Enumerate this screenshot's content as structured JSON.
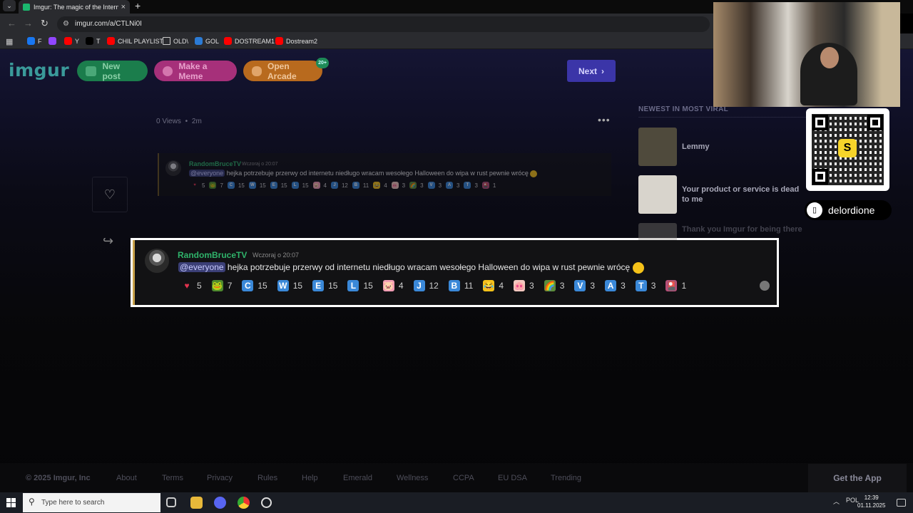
{
  "browser": {
    "tab_title": "Imgur: The magic of the Interne",
    "url": "imgur.com/a/CTLNi0I",
    "bookmarks": [
      {
        "label": "F",
        "color": "#1877f2"
      },
      {
        "label": "",
        "color": "#9146ff"
      },
      {
        "label": "Y",
        "color": "#ff0000"
      },
      {
        "label": "T",
        "color": "#000000"
      },
      {
        "label": "CHIL PLAYLIST",
        "color": "#ff0000"
      },
      {
        "label": "OLD\\",
        "color": "folder"
      },
      {
        "label": "GOL",
        "color": "#2b7bd5"
      },
      {
        "label": "DOSTREAM1",
        "color": "#ff0000"
      },
      {
        "label": "Dostream2",
        "color": "#ff0000"
      }
    ]
  },
  "header": {
    "logo": "imgur",
    "new_post": "New post",
    "make_meme": "Make a Meme",
    "open_arcade": "Open Arcade",
    "arcade_badge": "20+",
    "next": "Next"
  },
  "post": {
    "views": "0 Views",
    "dot": "•",
    "age": "2m"
  },
  "message": {
    "username": "RandomBruceTV",
    "timestamp": "Wczoraj o 20:07",
    "mention": "@everyone",
    "text": "hejka potrzebuje przerwy od internetu niedługo wracam wesołego Halloween do wipa w rust pewnie wrócę",
    "reactions": [
      {
        "emoji": "♥",
        "bg": "transparent",
        "fg": "#e2334f",
        "count": "5"
      },
      {
        "emoji": "🐸",
        "bg": "#4e8a2e",
        "fg": "#fff",
        "count": "7"
      },
      {
        "emoji": "C",
        "bg": "#3a88d8",
        "fg": "#fff",
        "count": "15"
      },
      {
        "emoji": "W",
        "bg": "#3a88d8",
        "fg": "#fff",
        "count": "15"
      },
      {
        "emoji": "E",
        "bg": "#3a88d8",
        "fg": "#fff",
        "count": "15"
      },
      {
        "emoji": "L",
        "bg": "#3a88d8",
        "fg": "#fff",
        "count": "15"
      },
      {
        "emoji": "🐷",
        "bg": "#f19cb4",
        "fg": "#fff",
        "count": "4"
      },
      {
        "emoji": "J",
        "bg": "#3a88d8",
        "fg": "#fff",
        "count": "12"
      },
      {
        "emoji": "B",
        "bg": "#3a88d8",
        "fg": "#fff",
        "count": "11"
      },
      {
        "emoji": "😂",
        "bg": "#f5c219",
        "fg": "#000",
        "count": "4"
      },
      {
        "emoji": "🐽",
        "bg": "#f4c8bf",
        "fg": "#000",
        "count": "3"
      },
      {
        "emoji": "🌈",
        "bg": "#5b8d3a",
        "fg": "#fff",
        "count": "3"
      },
      {
        "emoji": "V",
        "bg": "#3a88d8",
        "fg": "#fff",
        "count": "3"
      },
      {
        "emoji": "A",
        "bg": "#3a88d8",
        "fg": "#fff",
        "count": "3"
      },
      {
        "emoji": "T",
        "bg": "#3a88d8",
        "fg": "#fff",
        "count": "3"
      },
      {
        "emoji": "🎴",
        "bg": "#b84e78",
        "fg": "#fff",
        "count": "1"
      }
    ]
  },
  "sidebar": {
    "heading": "NEWEST IN MOST VIRAL",
    "items": [
      {
        "title": "Lemmy",
        "thumb": "#4f4a3c"
      },
      {
        "title": "Your product or service is dead to me",
        "thumb": "#d8d4cc"
      },
      {
        "title": "Thank you Imgur for being there",
        "thumb": "#8f8a82"
      }
    ]
  },
  "overlay": {
    "qr_logo": "S",
    "social_handle": "delordione"
  },
  "footer": {
    "copyright": "© 2025 Imgur, Inc",
    "links": [
      "About",
      "Terms",
      "Privacy",
      "Rules",
      "Help",
      "Emerald",
      "Wellness",
      "CCPA",
      "EU DSA",
      "Trending"
    ],
    "get_app": "Get the App"
  },
  "taskbar": {
    "search_placeholder": "Type here to search",
    "lang": "POL",
    "time": "12:39",
    "date": "01.11.2025"
  }
}
